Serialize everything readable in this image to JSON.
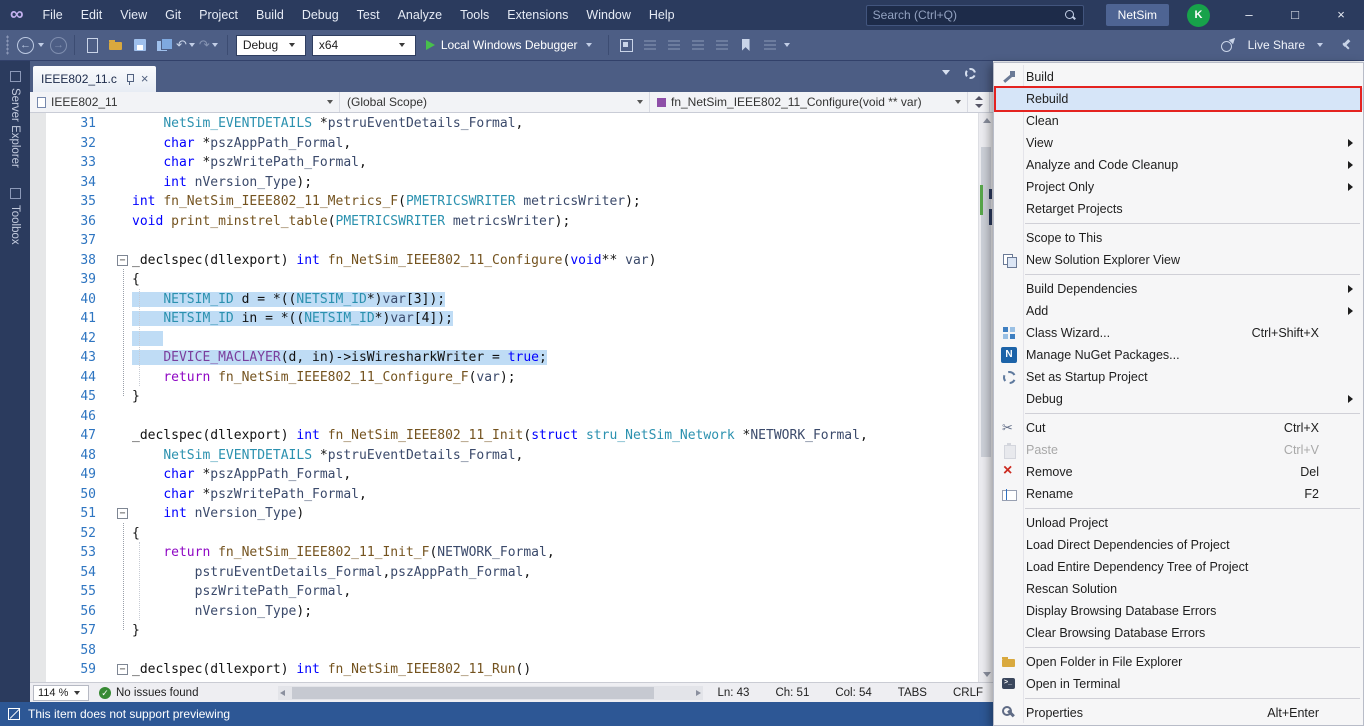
{
  "titlebar": {
    "menus": [
      "File",
      "Edit",
      "View",
      "Git",
      "Project",
      "Build",
      "Debug",
      "Test",
      "Analyze",
      "Tools",
      "Extensions",
      "Window",
      "Help"
    ],
    "search_placeholder": "Search (Ctrl+Q)",
    "solution_badge": "NetSim",
    "avatar_initial": "K",
    "window": {
      "minimize": "–",
      "maximize": "□",
      "close": "×"
    }
  },
  "toolbar": {
    "config": "Debug",
    "platform": "x64",
    "run_label": "Local Windows Debugger",
    "live_share": "Live Share"
  },
  "side_tabs": [
    "Server Explorer",
    "Toolbox"
  ],
  "editor": {
    "tab_title": "IEEE802_11.c",
    "navbar": {
      "project": "IEEE802_11",
      "scope": "(Global Scope)",
      "member": "fn_NetSim_IEEE802_11_Configure(void ** var)"
    },
    "status": {
      "zoom": "114 %",
      "health": "No issues found",
      "ln": "Ln: 43",
      "ch": "Ch: 51",
      "col": "Col: 54",
      "tabs": "TABS",
      "eol": "CRLF"
    },
    "lines": [
      {
        "n": 31,
        "ind": 1,
        "t": [
          [
            "NetSim_EVENTDETAILS",
            "t"
          ],
          [
            " *",
            "p"
          ],
          [
            "pstruEventDetails_Formal",
            "v"
          ],
          [
            ",",
            "p"
          ]
        ]
      },
      {
        "n": 32,
        "ind": 1,
        "t": [
          [
            "char",
            "k"
          ],
          [
            " *",
            "p"
          ],
          [
            "pszAppPath_Formal",
            "v"
          ],
          [
            ",",
            "p"
          ]
        ]
      },
      {
        "n": 33,
        "ind": 1,
        "t": [
          [
            "char",
            "k"
          ],
          [
            " *",
            "p"
          ],
          [
            "pszWritePath_Formal",
            "v"
          ],
          [
            ",",
            "p"
          ]
        ]
      },
      {
        "n": 34,
        "ind": 1,
        "t": [
          [
            "int",
            "k"
          ],
          [
            " ",
            "p"
          ],
          [
            "nVersion_Type",
            "v"
          ],
          [
            ");",
            "p"
          ]
        ]
      },
      {
        "n": 35,
        "ind": 0,
        "t": [
          [
            "int",
            "k"
          ],
          [
            " ",
            "p"
          ],
          [
            "fn_NetSim_IEEE802_11_Metrics_F",
            "f"
          ],
          [
            "(",
            "p"
          ],
          [
            "PMETRICSWRITER",
            "t"
          ],
          [
            " ",
            "p"
          ],
          [
            "metricsWriter",
            "v"
          ],
          [
            ");",
            "p"
          ]
        ]
      },
      {
        "n": 36,
        "ind": 0,
        "t": [
          [
            "void",
            "k"
          ],
          [
            " ",
            "p"
          ],
          [
            "print_minstrel_table",
            "f"
          ],
          [
            "(",
            "p"
          ],
          [
            "PMETRICSWRITER",
            "t"
          ],
          [
            " ",
            "p"
          ],
          [
            "metricsWriter",
            "v"
          ],
          [
            ");",
            "p"
          ]
        ]
      },
      {
        "n": 37,
        "ind": 0,
        "t": []
      },
      {
        "n": 38,
        "ind": 0,
        "fold": true,
        "t": [
          [
            "_declspec(dllexport) ",
            "p"
          ],
          [
            "int",
            "k"
          ],
          [
            " ",
            "p"
          ],
          [
            "fn_NetSim_IEEE802_11_Configure",
            "f"
          ],
          [
            "(",
            "p"
          ],
          [
            "void",
            "k"
          ],
          [
            "** ",
            "p"
          ],
          [
            "var",
            "v"
          ],
          [
            ")",
            "p"
          ]
        ]
      },
      {
        "n": 39,
        "ind": 0,
        "t": [
          [
            "{",
            "p"
          ]
        ]
      },
      {
        "n": 40,
        "ind": 1,
        "sel": true,
        "t": [
          [
            "NETSIM_ID",
            "t"
          ],
          [
            " d = *((",
            "p"
          ],
          [
            "NETSIM_ID",
            "t"
          ],
          [
            "*)",
            "p"
          ],
          [
            "var",
            "v"
          ],
          [
            "[3]);",
            "p"
          ]
        ]
      },
      {
        "n": 41,
        "ind": 1,
        "sel": true,
        "t": [
          [
            "NETSIM_ID",
            "t"
          ],
          [
            " in = *((",
            "p"
          ],
          [
            "NETSIM_ID",
            "t"
          ],
          [
            "*)",
            "p"
          ],
          [
            "var",
            "v"
          ],
          [
            "[4]);",
            "p"
          ]
        ]
      },
      {
        "n": 42,
        "ind": 1,
        "sel": true,
        "t": []
      },
      {
        "n": 43,
        "ind": 1,
        "sel": true,
        "t": [
          [
            "DEVICE_MACLAYER",
            "m"
          ],
          [
            "(d, in)->isWiresharkWriter = ",
            "p"
          ],
          [
            "true",
            "k"
          ],
          [
            ";",
            "p"
          ]
        ]
      },
      {
        "n": 44,
        "ind": 1,
        "t": [
          [
            "return",
            "c"
          ],
          [
            " ",
            "p"
          ],
          [
            "fn_NetSim_IEEE802_11_Configure_F",
            "f"
          ],
          [
            "(",
            "p"
          ],
          [
            "var",
            "v"
          ],
          [
            ");",
            "p"
          ]
        ]
      },
      {
        "n": 45,
        "ind": 0,
        "t": [
          [
            "}",
            "p"
          ]
        ]
      },
      {
        "n": 46,
        "ind": 0,
        "t": []
      },
      {
        "n": 47,
        "ind": 0,
        "t": [
          [
            "_declspec(dllexport) ",
            "p"
          ],
          [
            "int",
            "k"
          ],
          [
            " ",
            "p"
          ],
          [
            "fn_NetSim_IEEE802_11_Init",
            "f"
          ],
          [
            "(",
            "p"
          ],
          [
            "struct",
            "k"
          ],
          [
            " ",
            "p"
          ],
          [
            "stru_NetSim_Network",
            "t"
          ],
          [
            " *",
            "p"
          ],
          [
            "NETWORK_Formal",
            "v"
          ],
          [
            ",",
            "p"
          ]
        ]
      },
      {
        "n": 48,
        "ind": 1,
        "t": [
          [
            "NetSim_EVENTDETAILS",
            "t"
          ],
          [
            " *",
            "p"
          ],
          [
            "pstruEventDetails_Formal",
            "v"
          ],
          [
            ",",
            "p"
          ]
        ]
      },
      {
        "n": 49,
        "ind": 1,
        "t": [
          [
            "char",
            "k"
          ],
          [
            " *",
            "p"
          ],
          [
            "pszAppPath_Formal",
            "v"
          ],
          [
            ",",
            "p"
          ]
        ]
      },
      {
        "n": 50,
        "ind": 1,
        "t": [
          [
            "char",
            "k"
          ],
          [
            " *",
            "p"
          ],
          [
            "pszWritePath_Formal",
            "v"
          ],
          [
            ",",
            "p"
          ]
        ]
      },
      {
        "n": 51,
        "ind": 1,
        "fold": true,
        "t": [
          [
            "int",
            "k"
          ],
          [
            " ",
            "p"
          ],
          [
            "nVersion_Type",
            "v"
          ],
          [
            ")",
            "p"
          ]
        ]
      },
      {
        "n": 52,
        "ind": 0,
        "t": [
          [
            "{",
            "p"
          ]
        ]
      },
      {
        "n": 53,
        "ind": 1,
        "t": [
          [
            "return",
            "c"
          ],
          [
            " ",
            "p"
          ],
          [
            "fn_NetSim_IEEE802_11_Init_F",
            "f"
          ],
          [
            "(",
            "p"
          ],
          [
            "NETWORK_Formal",
            "v"
          ],
          [
            ",",
            "p"
          ]
        ]
      },
      {
        "n": 54,
        "ind": 2,
        "t": [
          [
            "pstruEventDetails_Formal",
            "v"
          ],
          [
            ",",
            "p"
          ],
          [
            "pszAppPath_Formal",
            "v"
          ],
          [
            ",",
            "p"
          ]
        ]
      },
      {
        "n": 55,
        "ind": 2,
        "t": [
          [
            "pszWritePath_Formal",
            "v"
          ],
          [
            ",",
            "p"
          ]
        ]
      },
      {
        "n": 56,
        "ind": 2,
        "t": [
          [
            "nVersion_Type",
            "v"
          ],
          [
            ");",
            "p"
          ]
        ]
      },
      {
        "n": 57,
        "ind": 0,
        "t": [
          [
            "}",
            "p"
          ]
        ]
      },
      {
        "n": 58,
        "ind": 0,
        "t": []
      },
      {
        "n": 59,
        "ind": 0,
        "fold": true,
        "t": [
          [
            "_declspec(dllexport) ",
            "p"
          ],
          [
            "int",
            "k"
          ],
          [
            " ",
            "p"
          ],
          [
            "fn_NetSim_IEEE802_11_Run",
            "f"
          ],
          [
            "()",
            "p"
          ]
        ]
      }
    ]
  },
  "context_menu": {
    "items": [
      {
        "label": "Build",
        "icon": "build-icon"
      },
      {
        "label": "Rebuild",
        "highlighted": true
      },
      {
        "label": "Clean"
      },
      {
        "label": "View",
        "submenu": true
      },
      {
        "label": "Analyze and Code Cleanup",
        "submenu": true
      },
      {
        "label": "Project Only",
        "submenu": true
      },
      {
        "label": "Retarget Projects"
      },
      {
        "separator": true
      },
      {
        "label": "Scope to This"
      },
      {
        "label": "New Solution Explorer View",
        "icon": "solution-explorer-view-icon"
      },
      {
        "separator": true
      },
      {
        "label": "Build Dependencies",
        "submenu": true
      },
      {
        "label": "Add",
        "submenu": true
      },
      {
        "label": "Class Wizard...",
        "shortcut": "Ctrl+Shift+X",
        "icon": "class-wizard-icon"
      },
      {
        "label": "Manage NuGet Packages...",
        "icon": "nuget-icon"
      },
      {
        "label": "Set as Startup Project",
        "icon": "startup-project-icon"
      },
      {
        "label": "Debug",
        "submenu": true
      },
      {
        "separator": true
      },
      {
        "label": "Cut",
        "shortcut": "Ctrl+X",
        "icon": "cut-icon"
      },
      {
        "label": "Paste",
        "shortcut": "Ctrl+V",
        "icon": "paste-icon",
        "disabled": true
      },
      {
        "label": "Remove",
        "shortcut": "Del",
        "icon": "remove-icon"
      },
      {
        "label": "Rename",
        "shortcut": "F2",
        "icon": "rename-icon"
      },
      {
        "separator": true
      },
      {
        "label": "Unload Project"
      },
      {
        "label": "Load Direct Dependencies of Project"
      },
      {
        "label": "Load Entire Dependency Tree of Project"
      },
      {
        "label": "Rescan Solution"
      },
      {
        "label": "Display Browsing Database Errors"
      },
      {
        "label": "Clear Browsing Database Errors"
      },
      {
        "separator": true
      },
      {
        "label": "Open Folder in File Explorer",
        "icon": "folder-icon"
      },
      {
        "label": "Open in Terminal",
        "icon": "terminal-icon"
      },
      {
        "separator": true
      },
      {
        "label": "Properties",
        "shortcut": "Alt+Enter",
        "icon": "properties-icon"
      }
    ]
  },
  "statusbar": {
    "message": "This item does not support previewing"
  }
}
